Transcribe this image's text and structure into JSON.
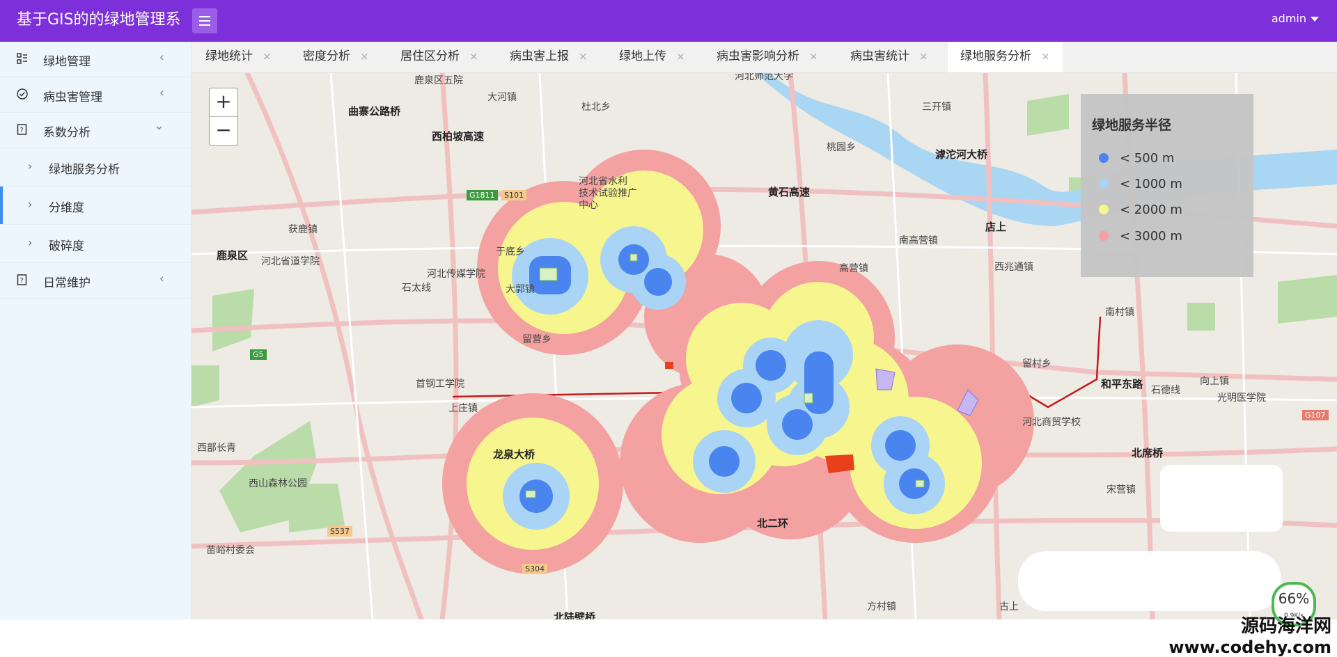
{
  "app": {
    "title": "基于GIS的的绿地管理系"
  },
  "user": {
    "name": "admin"
  },
  "sidebar": {
    "items": [
      {
        "label": "绿地管理",
        "arrow": "‹"
      },
      {
        "label": "病虫害管理",
        "arrow": "‹"
      },
      {
        "label": "系数分析",
        "arrow": "⌄"
      },
      {
        "label": "日常维护",
        "arrow": "‹"
      }
    ],
    "sub_items": [
      {
        "label": "绿地服务分析"
      },
      {
        "label": "分维度"
      },
      {
        "label": "破碎度"
      }
    ]
  },
  "tabs": [
    {
      "label": "绿地统计"
    },
    {
      "label": "密度分析"
    },
    {
      "label": "居住区分析"
    },
    {
      "label": "病虫害上报"
    },
    {
      "label": "绿地上传"
    },
    {
      "label": "病虫害影响分析"
    },
    {
      "label": "病虫害统计"
    },
    {
      "label": "绿地服务分析"
    }
  ],
  "tab_close": "×",
  "zoom": {
    "in": "+",
    "out": "−"
  },
  "legend": {
    "title": "绿地服务半径",
    "items": [
      {
        "label": "< 500 m",
        "color": "#4a84ee"
      },
      {
        "label": "< 1000 m",
        "color": "#a9d4f6"
      },
      {
        "label": "< 2000 m",
        "color": "#f7f58e"
      },
      {
        "label": "< 3000 m",
        "color": "#f3a1a1"
      }
    ]
  },
  "map_labels": [
    "鹿泉区五院",
    "大河镇",
    "杜北乡",
    "河北师范大学",
    "三开镇",
    "曲寨公路桥",
    "西柏坡高速",
    "桃园乡",
    "滹沱河大桥",
    "河北省水利",
    "技术试验推广",
    "中心",
    "黄石高速",
    "获鹿镇",
    "鹿泉区",
    "河北省道学院",
    "于底乡",
    "南高营镇",
    "店上",
    "河北传媒学院",
    "石太线",
    "大郭镇",
    "高营镇",
    "西兆通镇",
    "留营乡",
    "南村镇",
    "首钢工学院",
    "留村乡",
    "和平东路",
    "石德线",
    "向上镇",
    "光明医学院",
    "上庄镇",
    "河北商贸学校",
    "龙泉大桥",
    "北席桥",
    "西山森林公园",
    "宋营镇",
    "苗峪村委会",
    "北二环",
    "北陆壁桥",
    "方村镇",
    "古上",
    "西部长青",
    "G5",
    "G1811",
    "S101",
    "S537",
    "S304",
    "G107"
  ],
  "status": {
    "percent": "66%",
    "rate": "0.9K/s"
  },
  "watermark": {
    "line1": "源码海洋网",
    "line2": "www.codehy.com"
  }
}
